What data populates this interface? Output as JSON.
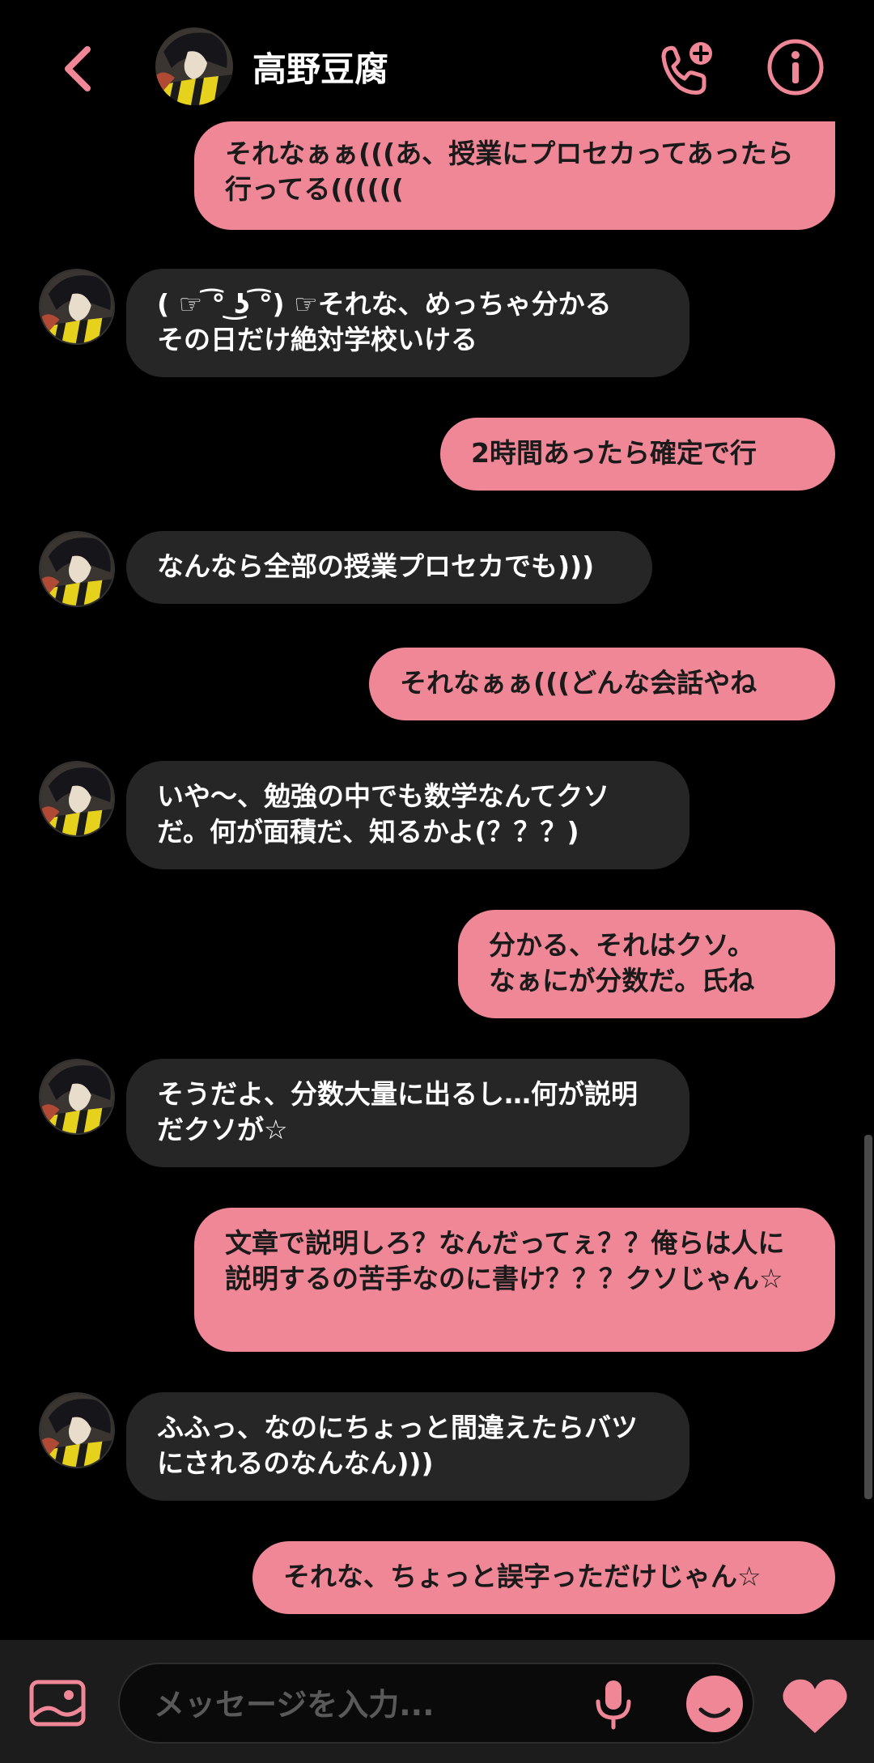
{
  "theme": {
    "accent": "#f08796",
    "background": "#000000",
    "incoming_bubble": "#262626"
  },
  "header": {
    "contact_name": "高野豆腐",
    "icons": {
      "back": "chevron-left-icon",
      "call": "phone-add-icon",
      "info": "info-icon"
    }
  },
  "messages": [
    {
      "sender": "me",
      "text": "それなぁぁ(((あ、授業にプロセカってあったら行ってる(((((("
    },
    {
      "sender": "them",
      "text": "( ☞ ͡° ͜ʖ ͡°) ☞それな、めっちゃ分かる\nその日だけ絶対学校いける"
    },
    {
      "sender": "me",
      "text": "2時間あったら確定で行"
    },
    {
      "sender": "them",
      "text": "なんなら全部の授業プロセカでも)))"
    },
    {
      "sender": "me",
      "text": "それなぁぁ(((どんな会話やね"
    },
    {
      "sender": "them",
      "text": "いや〜、勉強の中でも数学なんてクソだ。何が面積だ、知るかよ(？？？)"
    },
    {
      "sender": "me",
      "text": "分かる、それはクソ。\nなぁにが分数だ。氏ね"
    },
    {
      "sender": "them",
      "text": "そうだよ、分数大量に出るし…何が説明だクソが☆"
    },
    {
      "sender": "me",
      "text": "文章で説明しろ？なんだってぇ？？俺らは人に説明するの苦手なのに書け？？？クソじゃん☆"
    },
    {
      "sender": "them",
      "text": "ふふっ、なのにちょっと間違えたらバツにされるのなんなん)))"
    },
    {
      "sender": "me",
      "text": "それな、ちょっと誤字っただけじゃん☆"
    }
  ],
  "composer": {
    "placeholder": "メッセージを入力...",
    "value": "",
    "icons": {
      "gallery": "image-icon",
      "mic": "microphone-icon",
      "emoji": "smiley-icon",
      "like": "heart-icon"
    }
  }
}
